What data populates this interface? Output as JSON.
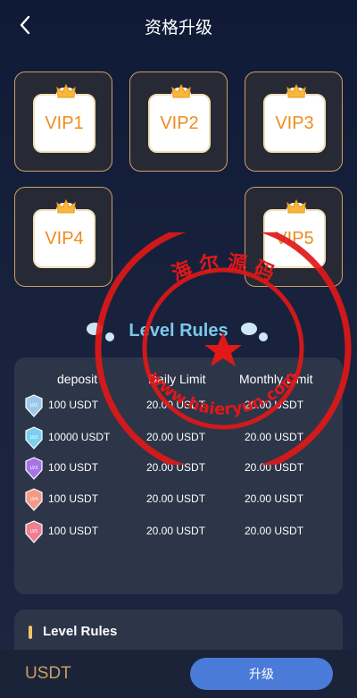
{
  "header": {
    "title": "资格升级"
  },
  "vip_levels": [
    {
      "label": "VIP1"
    },
    {
      "label": "VIP2"
    },
    {
      "label": "VIP3"
    },
    {
      "label": "VIP4"
    },
    {
      "label": "VIP5"
    }
  ],
  "rules": {
    "heading": "Level Rules",
    "columns": [
      "deposit",
      "Daily Limit",
      "Monthly Limit"
    ],
    "rows": [
      {
        "level": "LV1",
        "deposit": "100 USDT",
        "daily": "20.00 USDT",
        "monthly": "20.00 USDT",
        "icon_color": "#9dc8ea"
      },
      {
        "level": "LV2",
        "deposit": "10000 USDT",
        "daily": "20.00 USDT",
        "monthly": "20.00 USDT",
        "icon_color": "#7bd0f0"
      },
      {
        "level": "LV3",
        "deposit": "100 USDT",
        "daily": "20.00 USDT",
        "monthly": "20.00 USDT",
        "icon_color": "#a673e8"
      },
      {
        "level": "LV4",
        "deposit": "100 USDT",
        "daily": "20.00 USDT",
        "monthly": "20.00 USDT",
        "icon_color": "#f39a86"
      },
      {
        "level": "LV5",
        "deposit": "100 USDT",
        "daily": "20.00 USDT",
        "monthly": "20.00 USDT",
        "icon_color": "#ef7f91"
      }
    ]
  },
  "level_rules_section": {
    "label": "Level Rules"
  },
  "footer": {
    "currency": "USDT",
    "upgrade_label": "升级"
  },
  "watermark": {
    "top_text": "海 尔 源 码",
    "bottom_text": "www.haieryun.com"
  },
  "colors": {
    "gold": "#c9a063",
    "vip_text": "#ee8b1e",
    "accent_blue": "#4a7bd8",
    "heading": "#7ec9ea",
    "watermark_red": "#e01818"
  }
}
